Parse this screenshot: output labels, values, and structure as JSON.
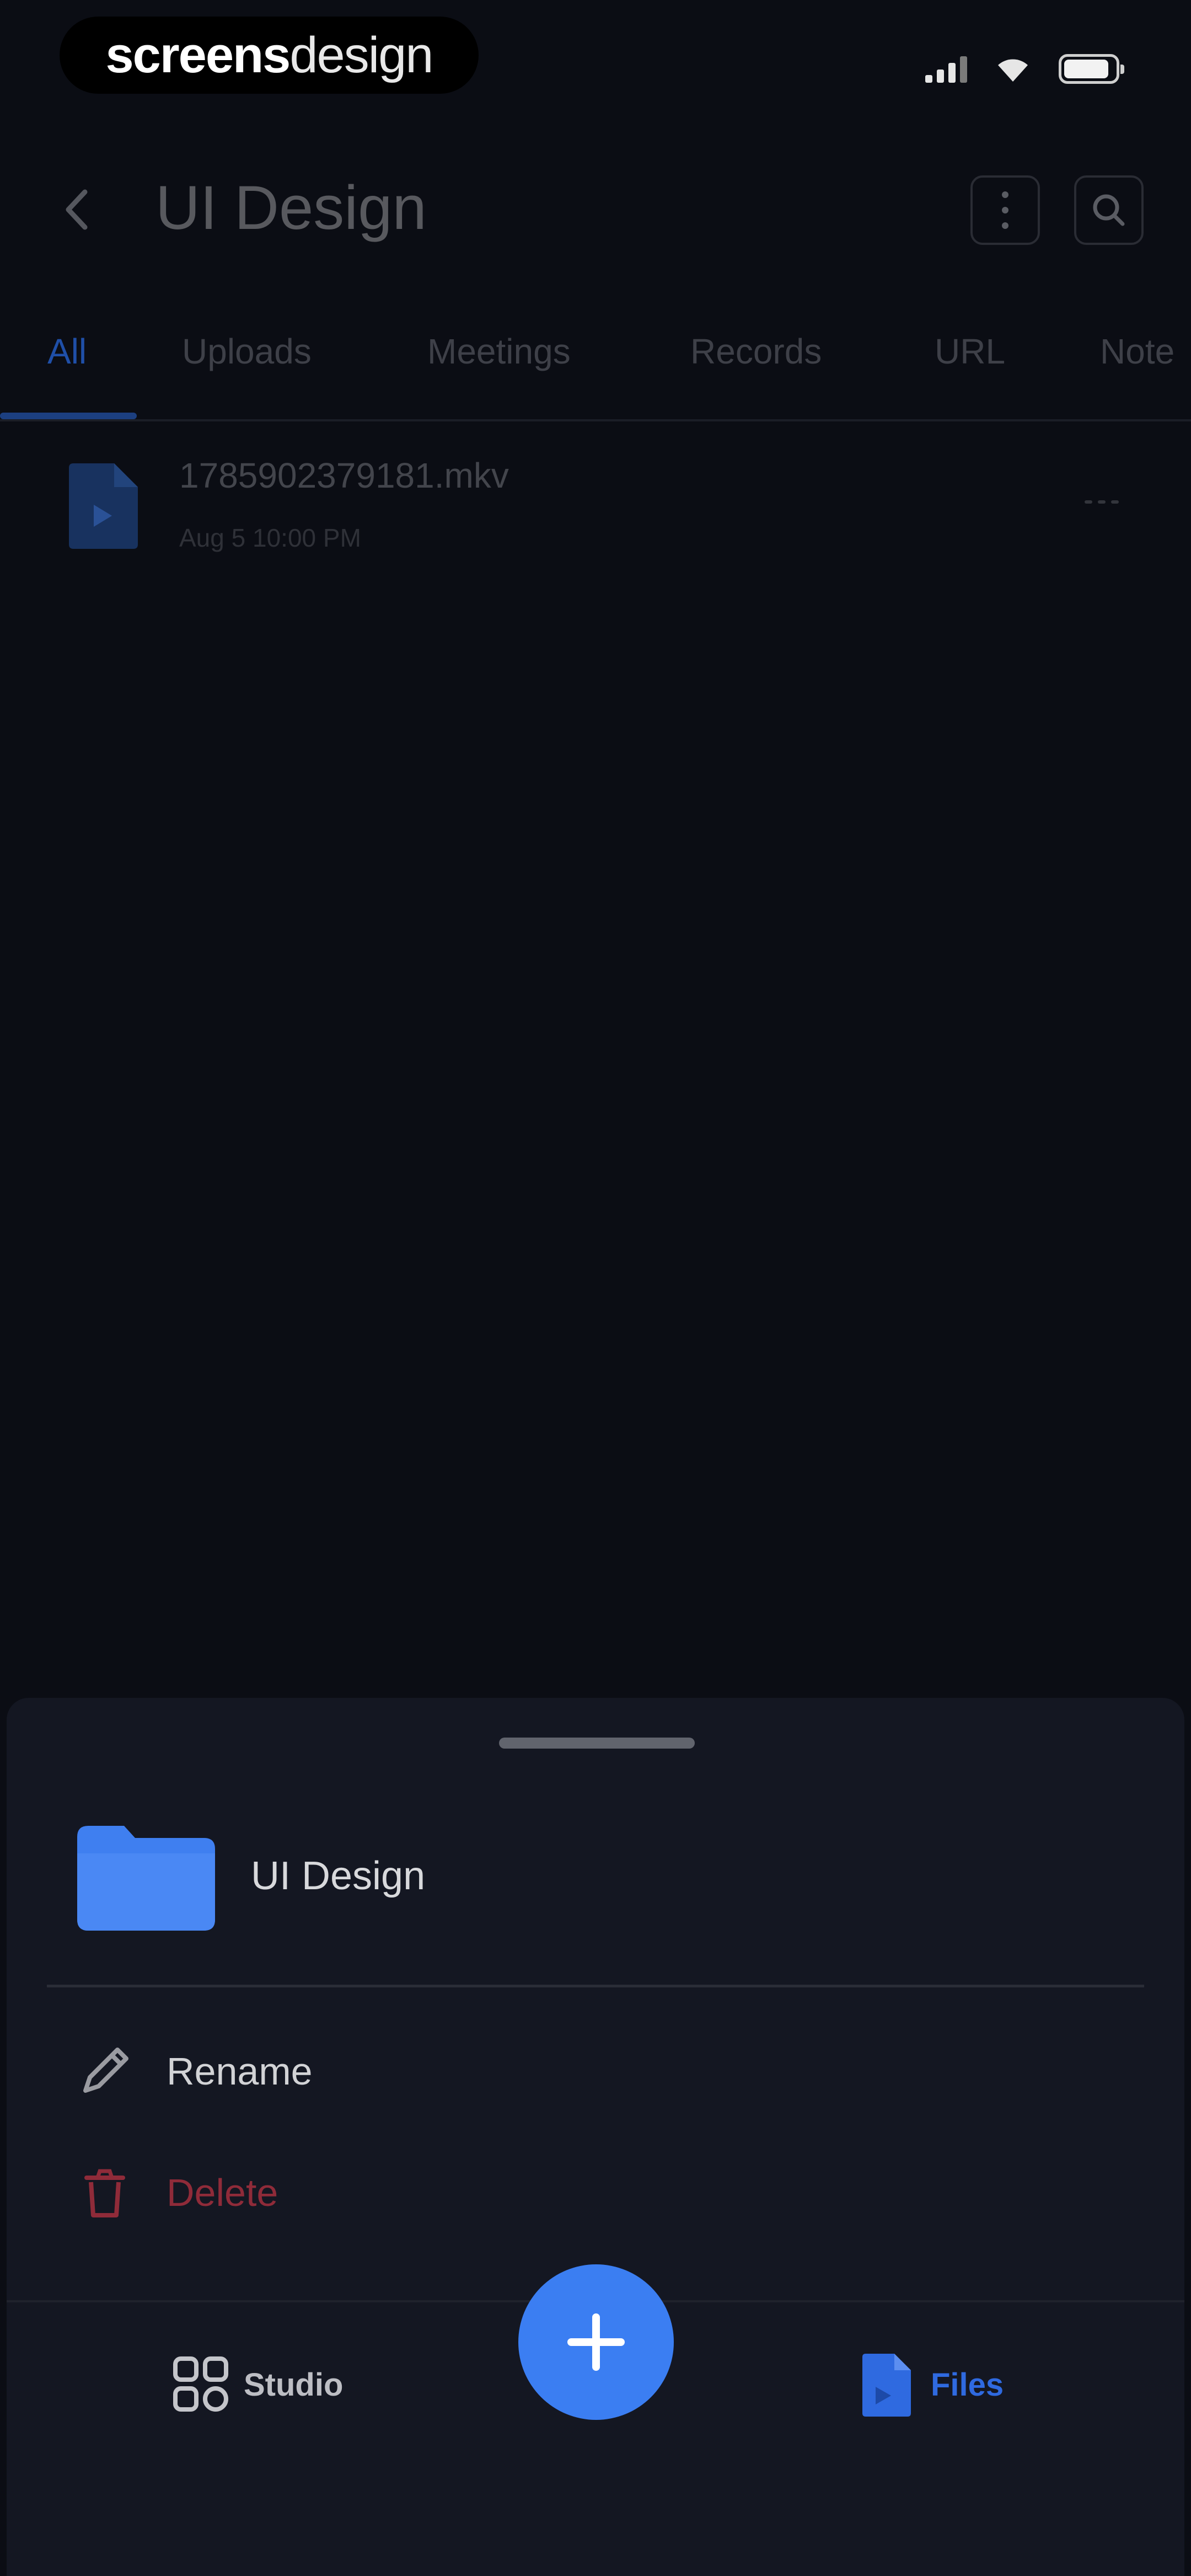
{
  "status_bar": {
    "watermark_bold": "screens",
    "watermark_light": "design"
  },
  "header": {
    "title": "UI Design",
    "back_icon": "chevron-left-icon",
    "more_icon": "vertical-dots-icon",
    "search_icon": "search-icon"
  },
  "tabs": [
    {
      "label": "All",
      "active": true
    },
    {
      "label": "Uploads",
      "active": false
    },
    {
      "label": "Meetings",
      "active": false
    },
    {
      "label": "Records",
      "active": false
    },
    {
      "label": "URL",
      "active": false
    },
    {
      "label": "Note",
      "active": false
    }
  ],
  "files": [
    {
      "name": "1785902379181.mkv",
      "date": "Aug 5 10:00 PM"
    }
  ],
  "sheet": {
    "folder_name": "UI Design",
    "actions": [
      {
        "label": "Rename",
        "icon": "pencil-icon"
      },
      {
        "label": "Delete",
        "icon": "trash-icon"
      }
    ]
  },
  "bottom_nav": {
    "studio_label": "Studio",
    "files_label": "Files",
    "add_icon": "plus-icon"
  },
  "colors": {
    "accent": "#3b7ef2",
    "delete": "#8f2b39",
    "background": "#0b0d14",
    "sheet": "#141722"
  }
}
